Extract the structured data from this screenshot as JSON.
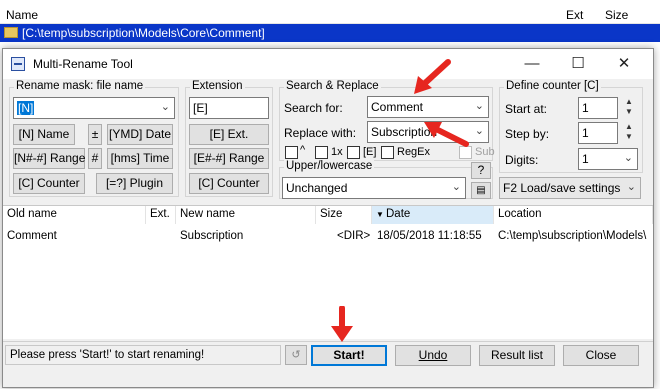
{
  "background": {
    "columns": {
      "name": "Name",
      "ext": "Ext",
      "size": "Size"
    },
    "selected_path": "[C:\\temp\\subscription\\Models\\Core\\Comment]"
  },
  "dialog": {
    "title": "Multi-Rename Tool",
    "rename_mask": {
      "title": "Rename mask: file name",
      "value": "[N]",
      "buttons": [
        "[N]  Name",
        "±",
        "[YMD]  Date",
        "[N#-#] Range",
        "#",
        "[hms]  Time",
        "[C]  Counter",
        "[=?]  Plugin"
      ]
    },
    "extension": {
      "title": "Extension",
      "value": "[E]",
      "buttons": [
        "[E]  Ext.",
        "[E#-#] Range",
        "[C]  Counter"
      ]
    },
    "search_replace": {
      "title": "Search & Replace",
      "search_label": "Search for:",
      "search_value": "Comment",
      "replace_label": "Replace with:",
      "replace_value": "Subscription",
      "options": [
        "^",
        "1x",
        "[E]",
        "RegEx",
        "Sub"
      ]
    },
    "upper_lower": {
      "title": "Upper/lowercase",
      "value": "Unchanged",
      "help": "?"
    },
    "counter": {
      "title": "Define counter [C]",
      "start_label": "Start at:",
      "start_value": "1",
      "step_label": "Step by:",
      "step_value": "1",
      "digits_label": "Digits:",
      "digits_value": "1"
    },
    "load_save": "F2 Load/save settings",
    "list": {
      "headers": [
        "Old name",
        "Ext.",
        "New name",
        "Size",
        "Date",
        "Location"
      ],
      "rows": [
        [
          "Comment",
          "",
          "Subscription",
          "<DIR>",
          "18/05/2018 11:18:55",
          "C:\\temp\\subscription\\Models\\"
        ]
      ]
    },
    "status_text": "Please press 'Start!' to start renaming!",
    "buttons": {
      "start": "Start!",
      "undo": "Undo",
      "result": "Result list",
      "close": "Close"
    }
  }
}
